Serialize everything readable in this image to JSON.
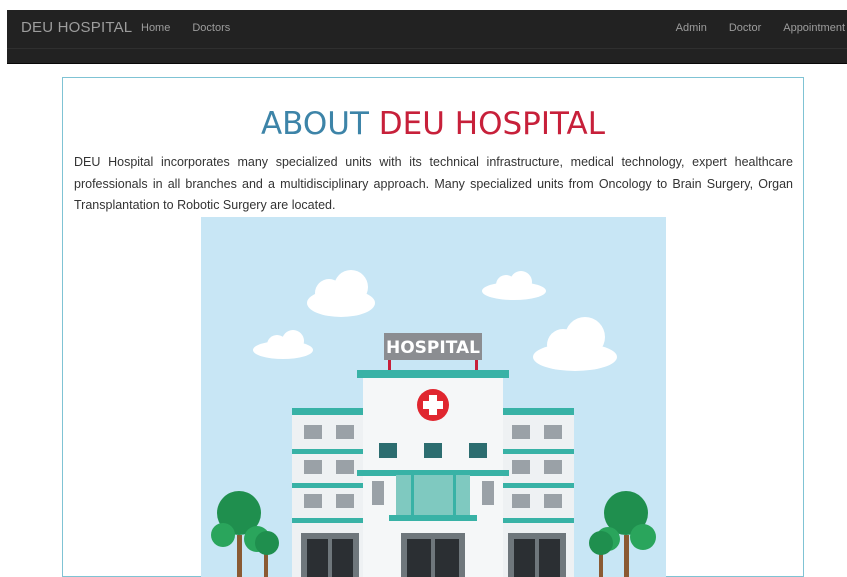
{
  "navbar": {
    "brand": "DEU HOSPITAL",
    "left_links": [
      "Home",
      "Doctors"
    ],
    "right_links": [
      "Admin",
      "Doctor",
      "Appointment"
    ]
  },
  "about": {
    "title_part1": "ABOUT",
    "title_part2": "DEU HOSPITAL",
    "intro": "DEU Hospital incorporates many specialized units with its technical infrastructure, medical technology, expert healthcare professionals in all branches and a multidisciplinary approach. Many specialized units from Oncology to Brain Surgery, Organ Transplantation to Robotic Surgery are located."
  },
  "illustration": {
    "sign_text": "HOSPITAL",
    "icon": "hospital-building-illustration"
  },
  "colors": {
    "navbar_bg": "#222222",
    "nav_text": "#9d9d9d",
    "title_blue": "#3d84a8",
    "title_red": "#c7203a",
    "box_border": "#7fc3d4",
    "sky": "#c8e6f5",
    "teal": "#38b2a6",
    "cross_red": "#e0262f"
  }
}
